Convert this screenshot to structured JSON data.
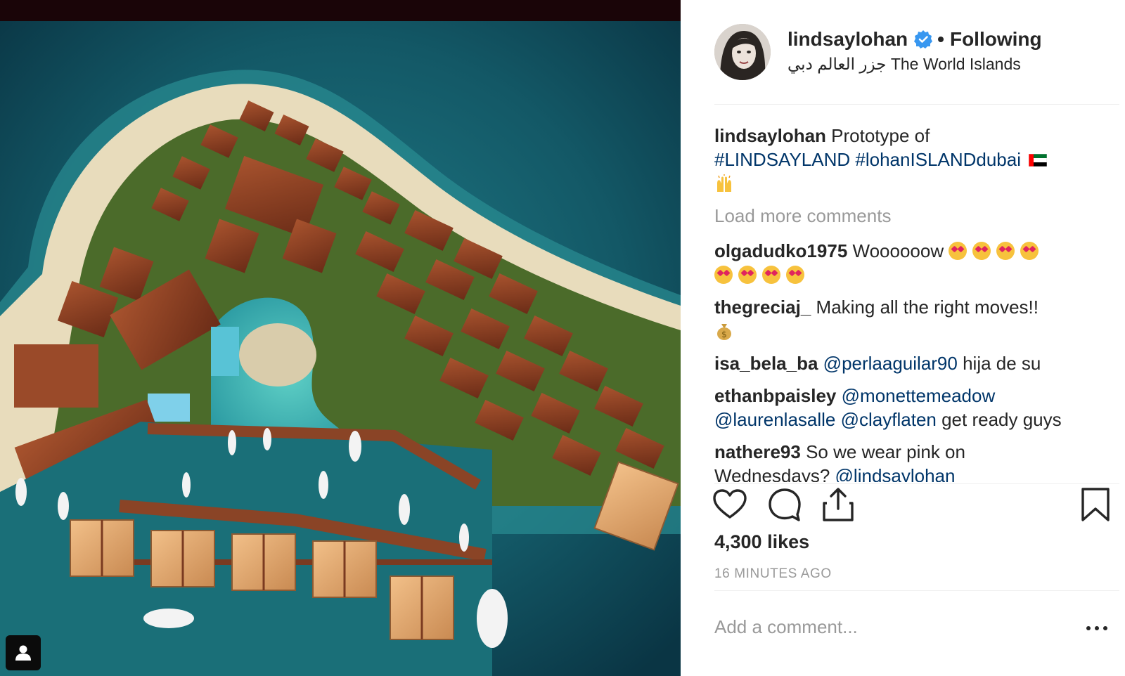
{
  "post": {
    "username": "lindsaylohan",
    "follow_status": "Following",
    "separator": "•",
    "location": "جزر العالم دبي The World Islands",
    "likes": "4,300 likes",
    "time_ago": "16 MINUTES AGO",
    "load_more": "Load more comments",
    "comment_placeholder": "Add a comment..."
  },
  "caption": {
    "user": "lindsaylohan",
    "text": "Prototype of",
    "tags": [
      "#LINDSAYLAND",
      "#lohanISLANDdubai"
    ]
  },
  "comments": [
    {
      "user": "olgadudko1975",
      "text": "Woooooow"
    },
    {
      "user": "thegreciaj_",
      "text": "Making all the right moves!!"
    },
    {
      "user": "isa_bela_ba",
      "mention": "@perlaaguilar90",
      "text": "hija de su"
    },
    {
      "user": "ethanbpaisley",
      "mentions": [
        "@monettemeadow",
        "@laurenlasalle",
        "@clayflaten"
      ],
      "text": "get ready guys"
    },
    {
      "user": "nathere93",
      "text": "So we wear pink on",
      "text2": "Wednesdays?",
      "mention": "@lindsaylohan"
    }
  ],
  "icons": {
    "verified": "verified-badge-icon",
    "like": "heart-icon",
    "comment": "speech-bubble-icon",
    "share": "share-icon",
    "save": "bookmark-icon",
    "options": "more-options-icon",
    "user_tags": "user-tag-icon"
  },
  "colors": {
    "text": "#262626",
    "muted": "#999999",
    "link": "#003569",
    "verified": "#3897f0",
    "divider": "#efefef"
  }
}
